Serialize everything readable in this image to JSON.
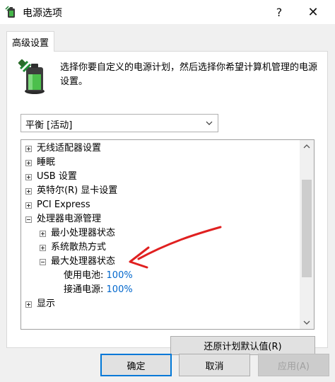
{
  "window": {
    "title": "电源选项",
    "help_label": "?",
    "close_label": "✕"
  },
  "tab": {
    "label": "高级设置"
  },
  "description": "选择你要自定义的电源计划，然后选择你希望计算机管理的电源设置。",
  "plan_select": {
    "value": "平衡 [活动]"
  },
  "tree": {
    "items": [
      {
        "label": "无线适配器设置",
        "expander": "plus"
      },
      {
        "label": "睡眠",
        "expander": "plus"
      },
      {
        "label": "USB 设置",
        "expander": "plus"
      },
      {
        "label": "英特尔(R) 显卡设置",
        "expander": "plus"
      },
      {
        "label": "PCI Express",
        "expander": "plus"
      },
      {
        "label": "处理器电源管理",
        "expander": "minus"
      },
      {
        "label": "最小处理器状态",
        "expander": "plus"
      },
      {
        "label": "系统散热方式",
        "expander": "plus"
      },
      {
        "label": "最大处理器状态",
        "expander": "minus"
      },
      {
        "label": "使用电池:",
        "value": "100%"
      },
      {
        "label": "接通电源:",
        "value": "100%"
      },
      {
        "label": "显示",
        "expander": "plus"
      }
    ]
  },
  "buttons": {
    "restore_defaults": "还原计划默认值(R)",
    "ok": "确定",
    "cancel": "取消",
    "apply": "应用(A)"
  },
  "colors": {
    "value_link": "#0066cc",
    "annotation_arrow": "#e02020",
    "focus_border": "#0078d7"
  },
  "icons": [
    "power-options-app-icon",
    "battery-icon",
    "help-icon",
    "close-icon",
    "chevron-down-icon",
    "scroll-up-icon",
    "scroll-down-icon"
  ]
}
